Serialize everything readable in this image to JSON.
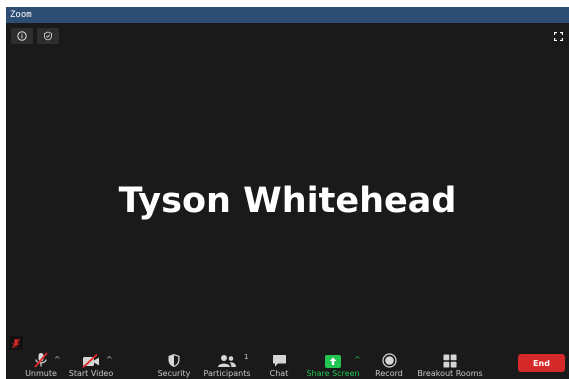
{
  "window": {
    "title": "Zoom"
  },
  "participant": {
    "display_name": "Tyson Whitehead",
    "audio_muted": true
  },
  "toolbar": {
    "unmute": "Unmute",
    "start_video": "Start Video",
    "security": "Security",
    "participants": "Participants",
    "participants_count": "1",
    "chat": "Chat",
    "share_screen": "Share Screen",
    "record": "Record",
    "breakout_rooms": "Breakout Rooms",
    "end": "End"
  },
  "colors": {
    "titlebar": "#2d4d73",
    "background": "#1a1a1a",
    "share_green": "#23c552",
    "end_red": "#d42a2a",
    "mute_red": "#e02828"
  },
  "icons": [
    "info-icon",
    "shield-check-icon",
    "fullscreen-icon",
    "mic-muted-icon",
    "video-off-icon",
    "shield-icon",
    "participants-icon",
    "chat-icon",
    "share-screen-icon",
    "record-icon",
    "breakout-rooms-icon"
  ]
}
